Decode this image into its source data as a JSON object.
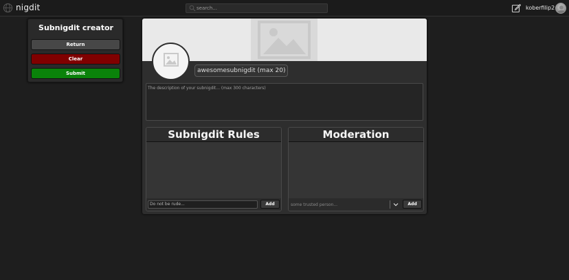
{
  "app": {
    "name": "nigdit",
    "logo_icon": "globe-icon"
  },
  "search": {
    "placeholder": "search...",
    "icon": "search-icon"
  },
  "user": {
    "username": "koberfilip2",
    "edit_icon": "edit-icon"
  },
  "creator": {
    "title": "Subnigdit creator",
    "return_label": "Return",
    "clear_label": "Clear",
    "submit_label": "Submit"
  },
  "subnigdit": {
    "name_placeholder": "awesomesubnigdit (max 20)",
    "description_placeholder": "The description of your subnigdit... (max 300 characters)"
  },
  "rules": {
    "title": "Subnigdit Rules",
    "input_placeholder": "Do not be rude...",
    "add_label": "Add"
  },
  "moderation": {
    "title": "Moderation",
    "input_placeholder": "some trusted person...",
    "add_label": "Add"
  },
  "colors": {
    "background": "#1e1e1e",
    "clear_button": "#800000",
    "submit_button": "#0a820a",
    "return_button": "#474747"
  }
}
